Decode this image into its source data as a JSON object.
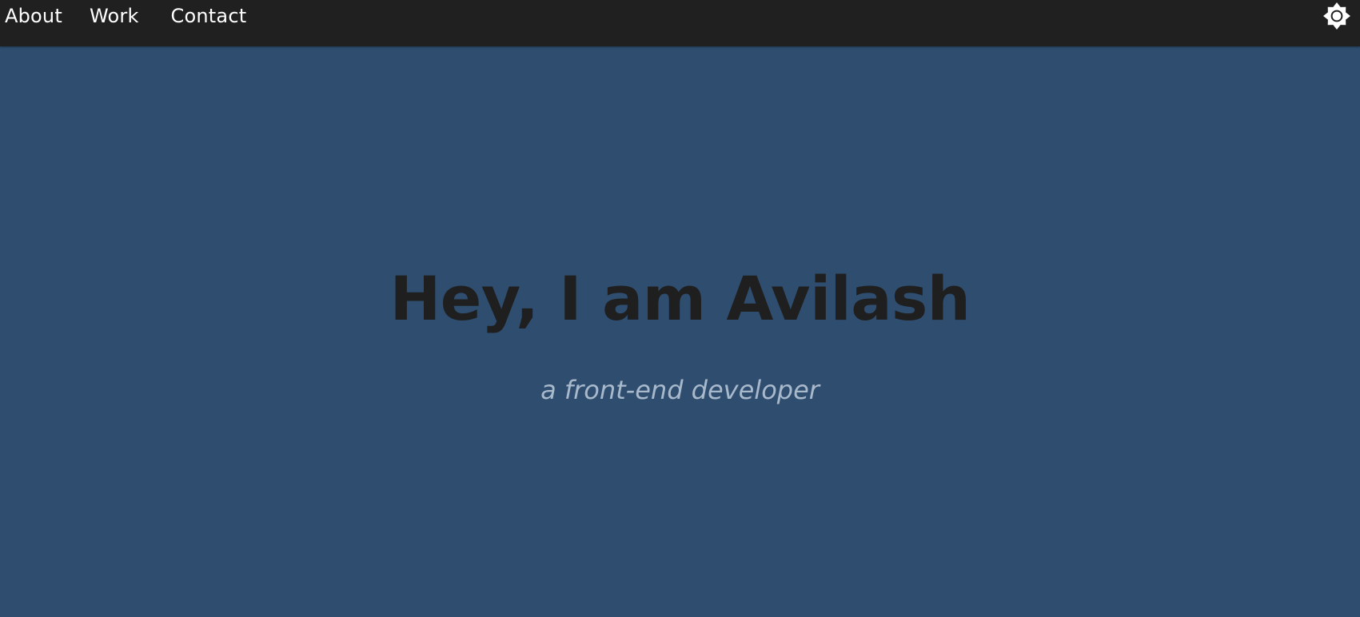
{
  "nav": {
    "links": [
      {
        "label": "About"
      },
      {
        "label": "Work"
      },
      {
        "label": "Contact"
      }
    ],
    "theme_toggle_icon": "sun-icon"
  },
  "hero": {
    "title": "Hey, I am Avilash",
    "subtitle": "a front-end developer"
  },
  "colors": {
    "navbar_bg": "#202020",
    "page_bg": "#2e4d6f",
    "title_text": "#1f1f1f",
    "subtitle_text": "#a9b9cc",
    "nav_text": "#ffffff"
  }
}
